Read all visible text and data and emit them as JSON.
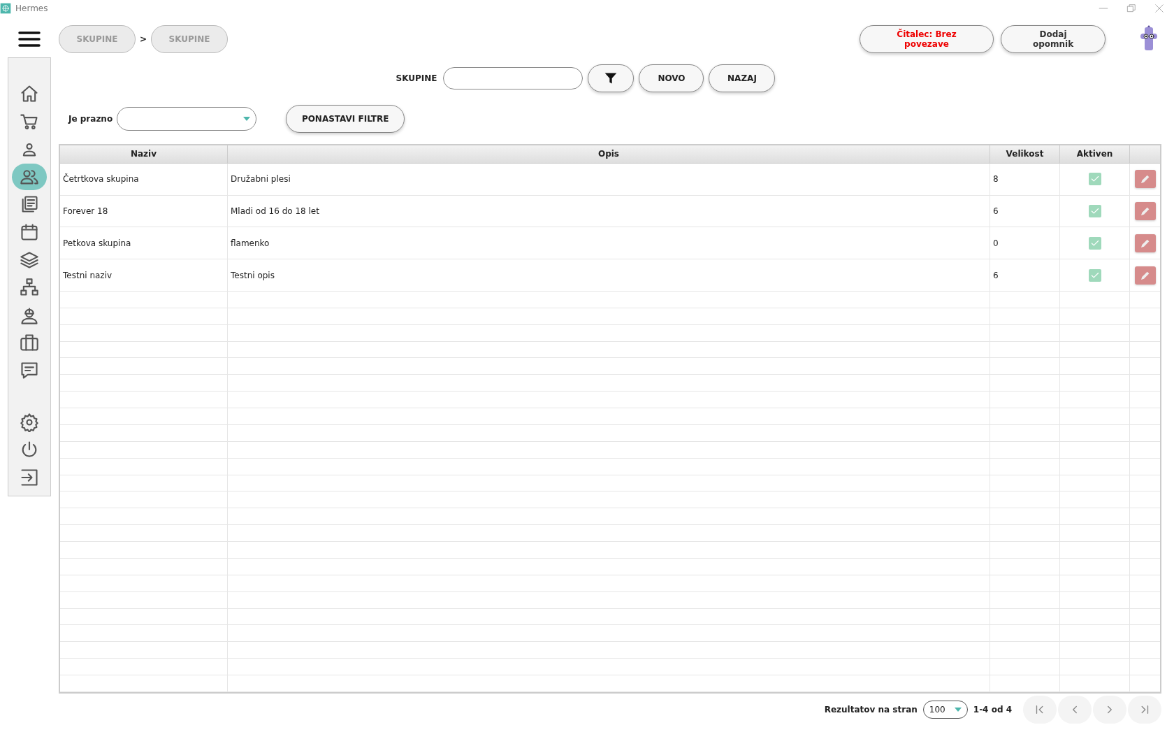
{
  "window": {
    "title": "Hermes"
  },
  "breadcrumbs": {
    "items": [
      "SKUPINE",
      "SKUPINE"
    ],
    "separator": ">"
  },
  "header_buttons": [
    {
      "label": "Čitalec: Brez povezave",
      "kind": "warning"
    },
    {
      "label": "Dodaj opomnik",
      "kind": "normal"
    }
  ],
  "sidebar": {
    "items": [
      {
        "selected": false
      },
      {
        "selected": false
      },
      {
        "selected": false
      },
      {
        "selected": true
      },
      {
        "selected": false
      },
      {
        "selected": false
      },
      {
        "selected": false
      },
      {
        "selected": false
      },
      {
        "selected": false
      },
      {
        "selected": false
      },
      {
        "selected": false
      }
    ],
    "bottom_items": [
      {
        "selected": false
      },
      {
        "selected": false
      },
      {
        "selected": false
      }
    ]
  },
  "search": {
    "label": "SKUPINE",
    "buttons": [
      "NOVO",
      "NAZAJ"
    ]
  },
  "filters": {
    "label": "Je prazno",
    "reset_button": "PONASTAVI FILTRE"
  },
  "table": {
    "columns": [
      "Naziv",
      "Opis",
      "Velikost",
      "Aktiven"
    ],
    "rows": [
      {
        "naziv": "Četrtkova skupina",
        "opis": "Družabni plesi",
        "velikost": "8",
        "aktiven": true
      },
      {
        "naziv": "Forever 18",
        "opis": "Mladi od 16 do 18 let",
        "velikost": "6",
        "aktiven": true
      },
      {
        "naziv": "Petkova skupina",
        "opis": "flamenko",
        "velikost": "0",
        "aktiven": true
      },
      {
        "naziv": "Testni naziv",
        "opis": "Testni opis",
        "velikost": "6",
        "aktiven": true
      }
    ]
  },
  "pagination": {
    "label": "Rezultatov na stran",
    "page_size": "100",
    "range": "1-4 od 4"
  }
}
